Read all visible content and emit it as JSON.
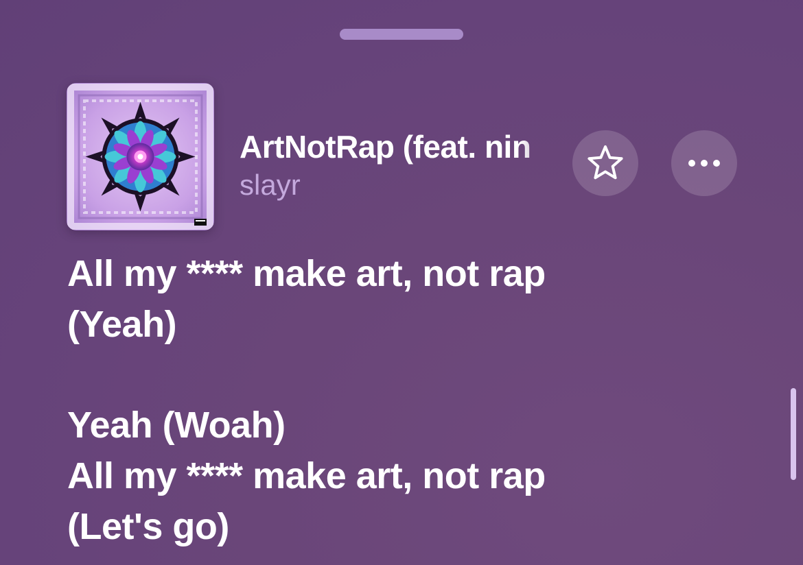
{
  "now_playing": {
    "title": "ArtNotRap (feat. nin",
    "artist": "slayr",
    "favorite_icon": "star-icon",
    "more_icon": "ellipsis-icon"
  },
  "lyrics": {
    "lines": [
      "All my **** make art, not rap",
      "(Yeah)",
      "",
      "Yeah (Woah)",
      "All my **** make art, not rap",
      "(Let's go)"
    ]
  },
  "theme": {
    "background": "#6a4679",
    "artist_color": "#c4a9dd",
    "grabber_color": "#a88bc8"
  }
}
